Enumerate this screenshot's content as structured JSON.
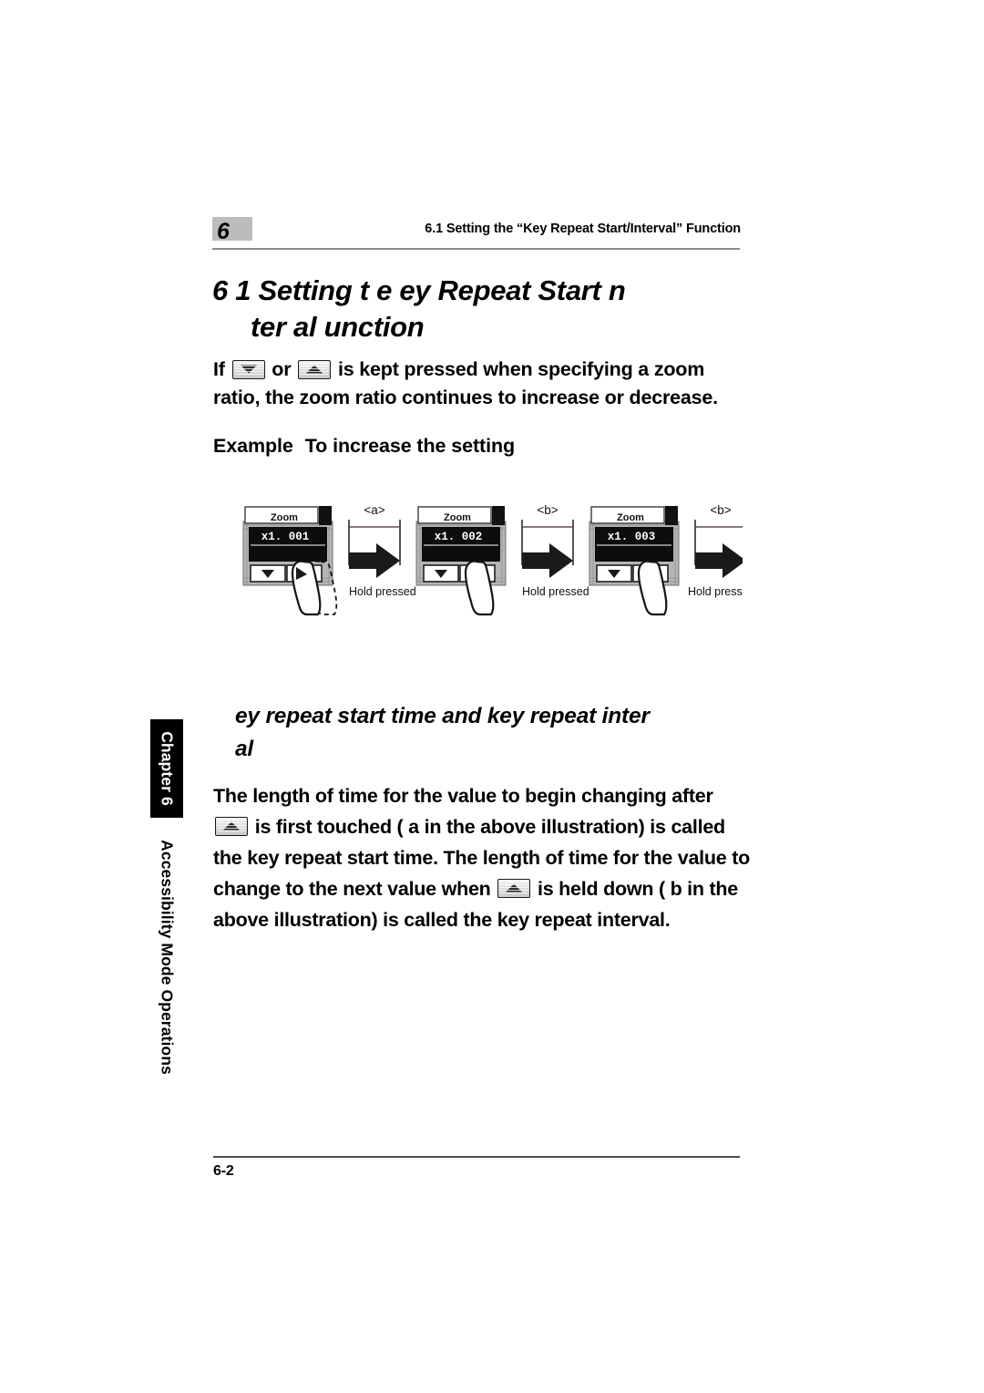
{
  "header": {
    "chapter_number": "6",
    "running_title": "6.1 Setting the “Key Repeat Start/Interval” Function"
  },
  "section": {
    "title_line1": "6 1  Setting t e   ey Repeat Start  n",
    "title_line2": "ter al   unction"
  },
  "intro": {
    "text_before_first_key": "If ",
    "text_between_keys": " or ",
    "text_after_keys": " is kept pressed when specifying a zoom ratio, the zoom ratio continues to increase or decrease.",
    "key_down_icon": "key-down-arrow-icon",
    "key_up_icon": "key-up-arrow-icon"
  },
  "example": {
    "label": "Example",
    "text": "To increase the setting"
  },
  "illustration": {
    "panels": [
      {
        "title": "Zoom",
        "value": "x1. 001",
        "hold_label": "Hold pressed",
        "bracket_label": "<a>",
        "ghost_finger": true
      },
      {
        "title": "Zoom",
        "value": "x1. 002",
        "hold_label": "Hold pressed",
        "bracket_label": "<b>",
        "ghost_finger": false
      },
      {
        "title": "Zoom",
        "value": "x1. 003",
        "hold_label": "Hold pressed",
        "bracket_label": "<b>",
        "ghost_finger": false
      }
    ],
    "ellipsis": "• • •",
    "down_button_icon": "lcd-down-arrow-button-icon",
    "up_button_icon": "lcd-up-arrow-button-icon",
    "arrow_icon": "right-arrow-icon",
    "finger_icon": "finger-press-icon"
  },
  "sub_heading": {
    "line1": "ey repeat start time and key repeat inter",
    "line2": "al"
  },
  "body": {
    "part1": "The length of time for the value to begin changing after ",
    "part2": " is first touched (  a   in the above illustration) is called the key repeat start time. The length of time for the value to change to the next value when ",
    "part3": " is held down (  b   in the above illustration) is called the key repeat interval."
  },
  "side_tab": {
    "tab_label": "Chapter 6",
    "chapter_name": "Accessibility Mode Operations"
  },
  "footer": {
    "page_number": "6-2"
  },
  "colors": {
    "badge_gray": "#bcbcbc",
    "rule_gray": "#8a8a8a",
    "tab_black": "#000000",
    "lcd_black": "#0d0d0d",
    "panel_gray": "#b5b5b5"
  }
}
